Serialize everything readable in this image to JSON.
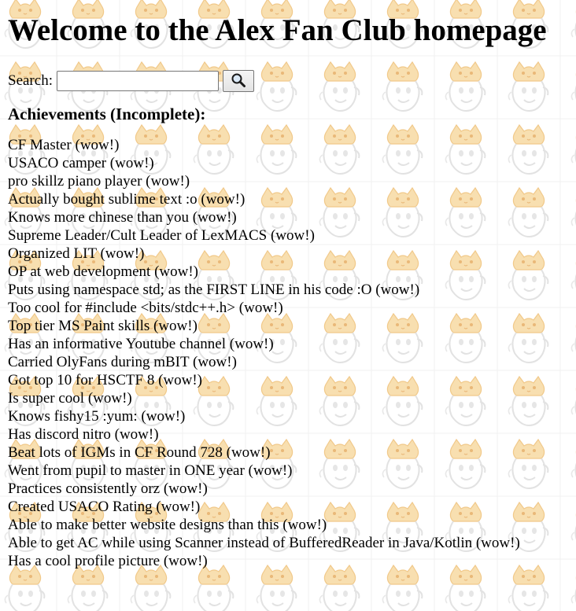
{
  "page": {
    "title": "Welcome to the Alex Fan Club homepage"
  },
  "search": {
    "label": "Search:",
    "value": "",
    "button_icon": "magnifier-icon"
  },
  "achievements": {
    "heading": "Achievements (Incomplete):",
    "items": [
      "CF Master (wow!)",
      "USACO camper (wow!)",
      "pro skillz piano player (wow!)",
      "Actually bought sublime text :o (wow!)",
      "Knows more chinese than you (wow!)",
      "Supreme Leader/Cult Leader of LexMACS (wow!)",
      "Organized LIT (wow!)",
      "OP at web development (wow!)",
      "Puts using namespace std; as the FIRST LINE in his code :O (wow!)",
      "Too cool for #include <bits/stdc++.h> (wow!)",
      "Top tier MS Paint skills (wow!)",
      "Has an informative Youtube channel (wow!)",
      "Carried OlyFans during mBIT (wow!)",
      "Got top 10 for HSCTF 8 (wow!)",
      "Is super cool (wow!)",
      "Knows fishy15 :yum: (wow!)",
      "Has discord nitro (wow!)",
      "Beat lots of IGMs in CF Round 728 (wow!)",
      "Went from pupil to master in ONE year (wow!)",
      "Practices consistently orz (wow!)",
      "Created USACO Rating (wow!)",
      "Able to make better website designs than this (wow!)",
      "Able to get AC while using Scanner instead of BufferedReader in Java/Kotlin (wow!)",
      "Has a cool profile picture (wow!)"
    ]
  },
  "background": {
    "tile_icon": "cat-face-icon",
    "colors": {
      "hat": "#f6d9a6",
      "face_outline": "#dcdcdc",
      "grid": "#eeeeee"
    }
  }
}
